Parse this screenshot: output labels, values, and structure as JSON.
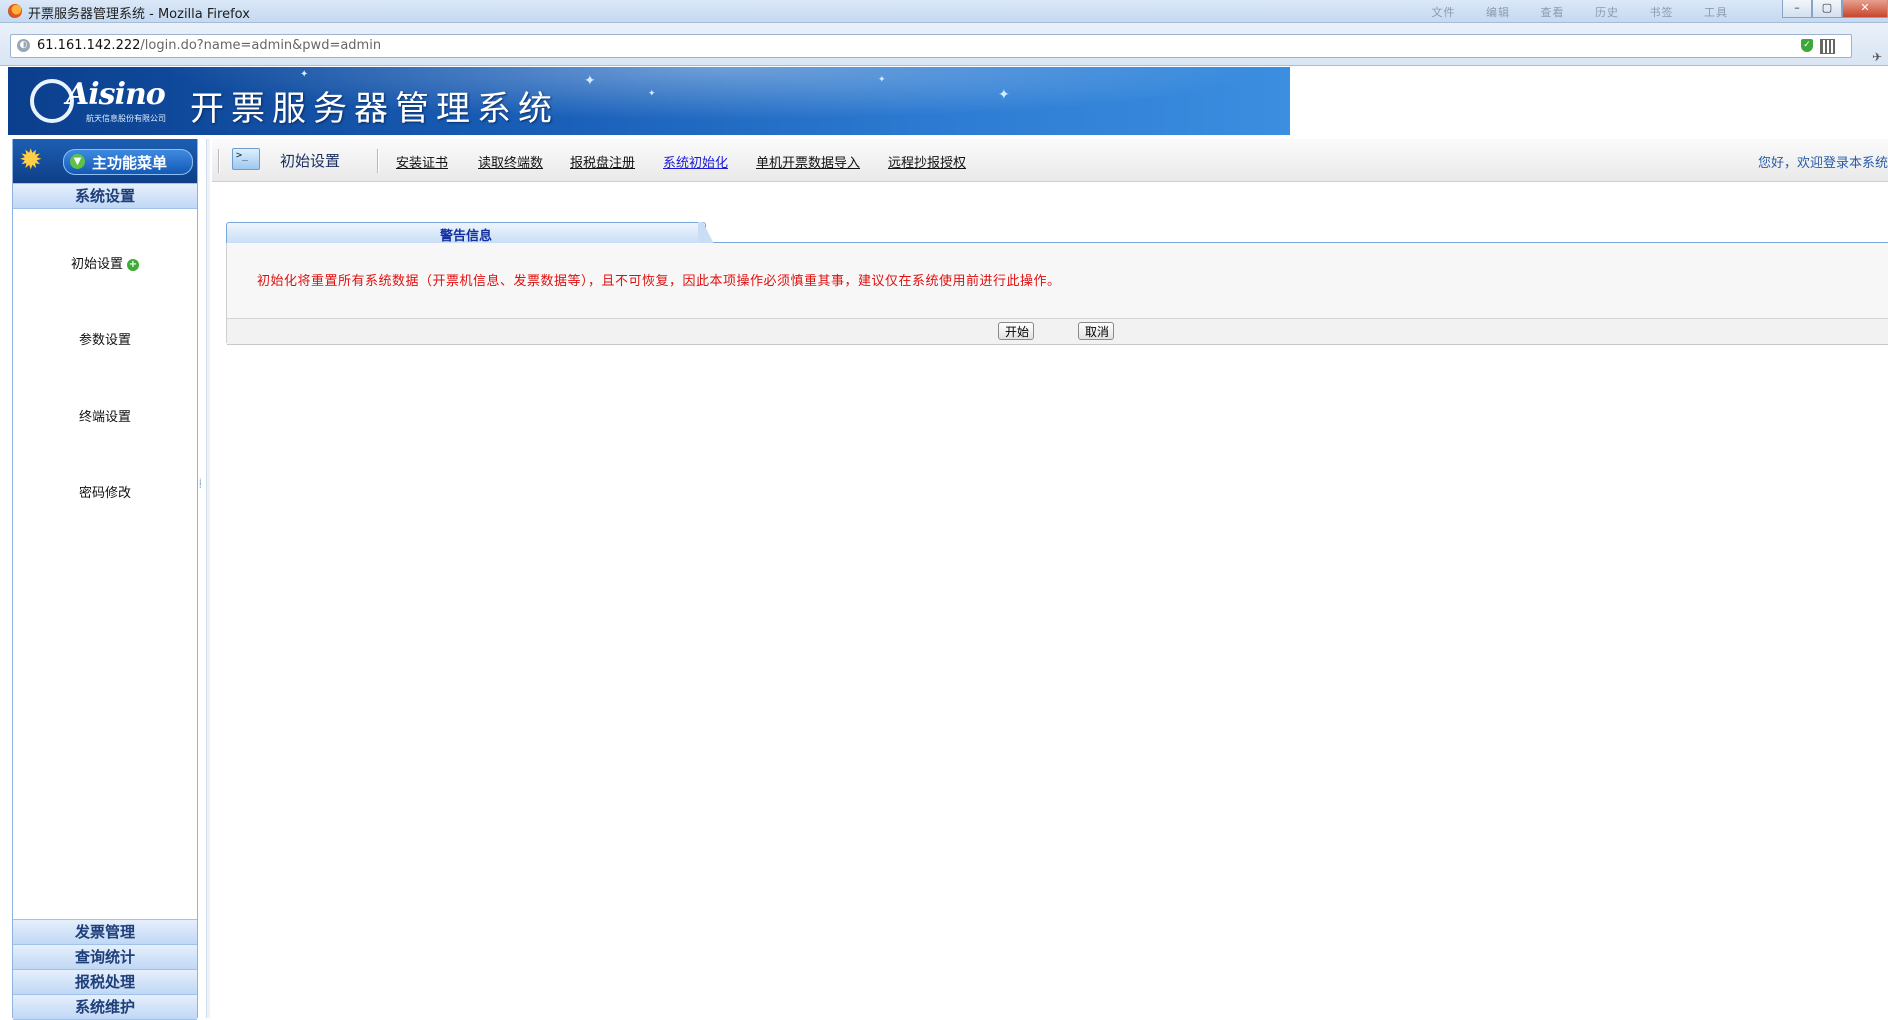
{
  "browser": {
    "window_title": "开票服务器管理系统 - Mozilla Firefox",
    "menu_items": [
      "文件",
      "编辑",
      "查看",
      "历史",
      "书签",
      "工具"
    ],
    "url_host": "61.161.142.222",
    "url_path": "/login.do?name=admin&pwd=admin"
  },
  "banner": {
    "logo_text": "Aisino",
    "logo_subtext": "航天信息股份有限公司",
    "title": "开票服务器管理系统"
  },
  "sidebar": {
    "menu_label": "主功能菜单",
    "active_section": "系统设置",
    "items": [
      {
        "label": "初始设置"
      },
      {
        "label": "参数设置"
      },
      {
        "label": "终端设置"
      },
      {
        "label": "密码修改"
      }
    ],
    "bottom_sections": [
      "发票管理",
      "查询统计",
      "报税处理",
      "系统维护"
    ]
  },
  "topnav": {
    "title": "初始设置",
    "links": [
      "安装证书",
      "读取终端数",
      "报税盘注册",
      "系统初始化",
      "单机开票数据导入",
      "远程抄报授权"
    ],
    "active_link": "系统初始化",
    "welcome": "您好，欢迎登录本系统"
  },
  "warning": {
    "tab_label": "警告信息",
    "message": "初始化将重置所有系统数据（开票机信息、发票数据等），且不可恢复，因此本项操作必须慎重其事，建议仅在系统使用前进行此操作。",
    "start_button": "开始",
    "cancel_button": "取消"
  },
  "colors": {
    "banner": "#185db6",
    "warning_text": "#e01010",
    "active_link": "#1b1bd6",
    "section_text": "#1f3f7a"
  }
}
